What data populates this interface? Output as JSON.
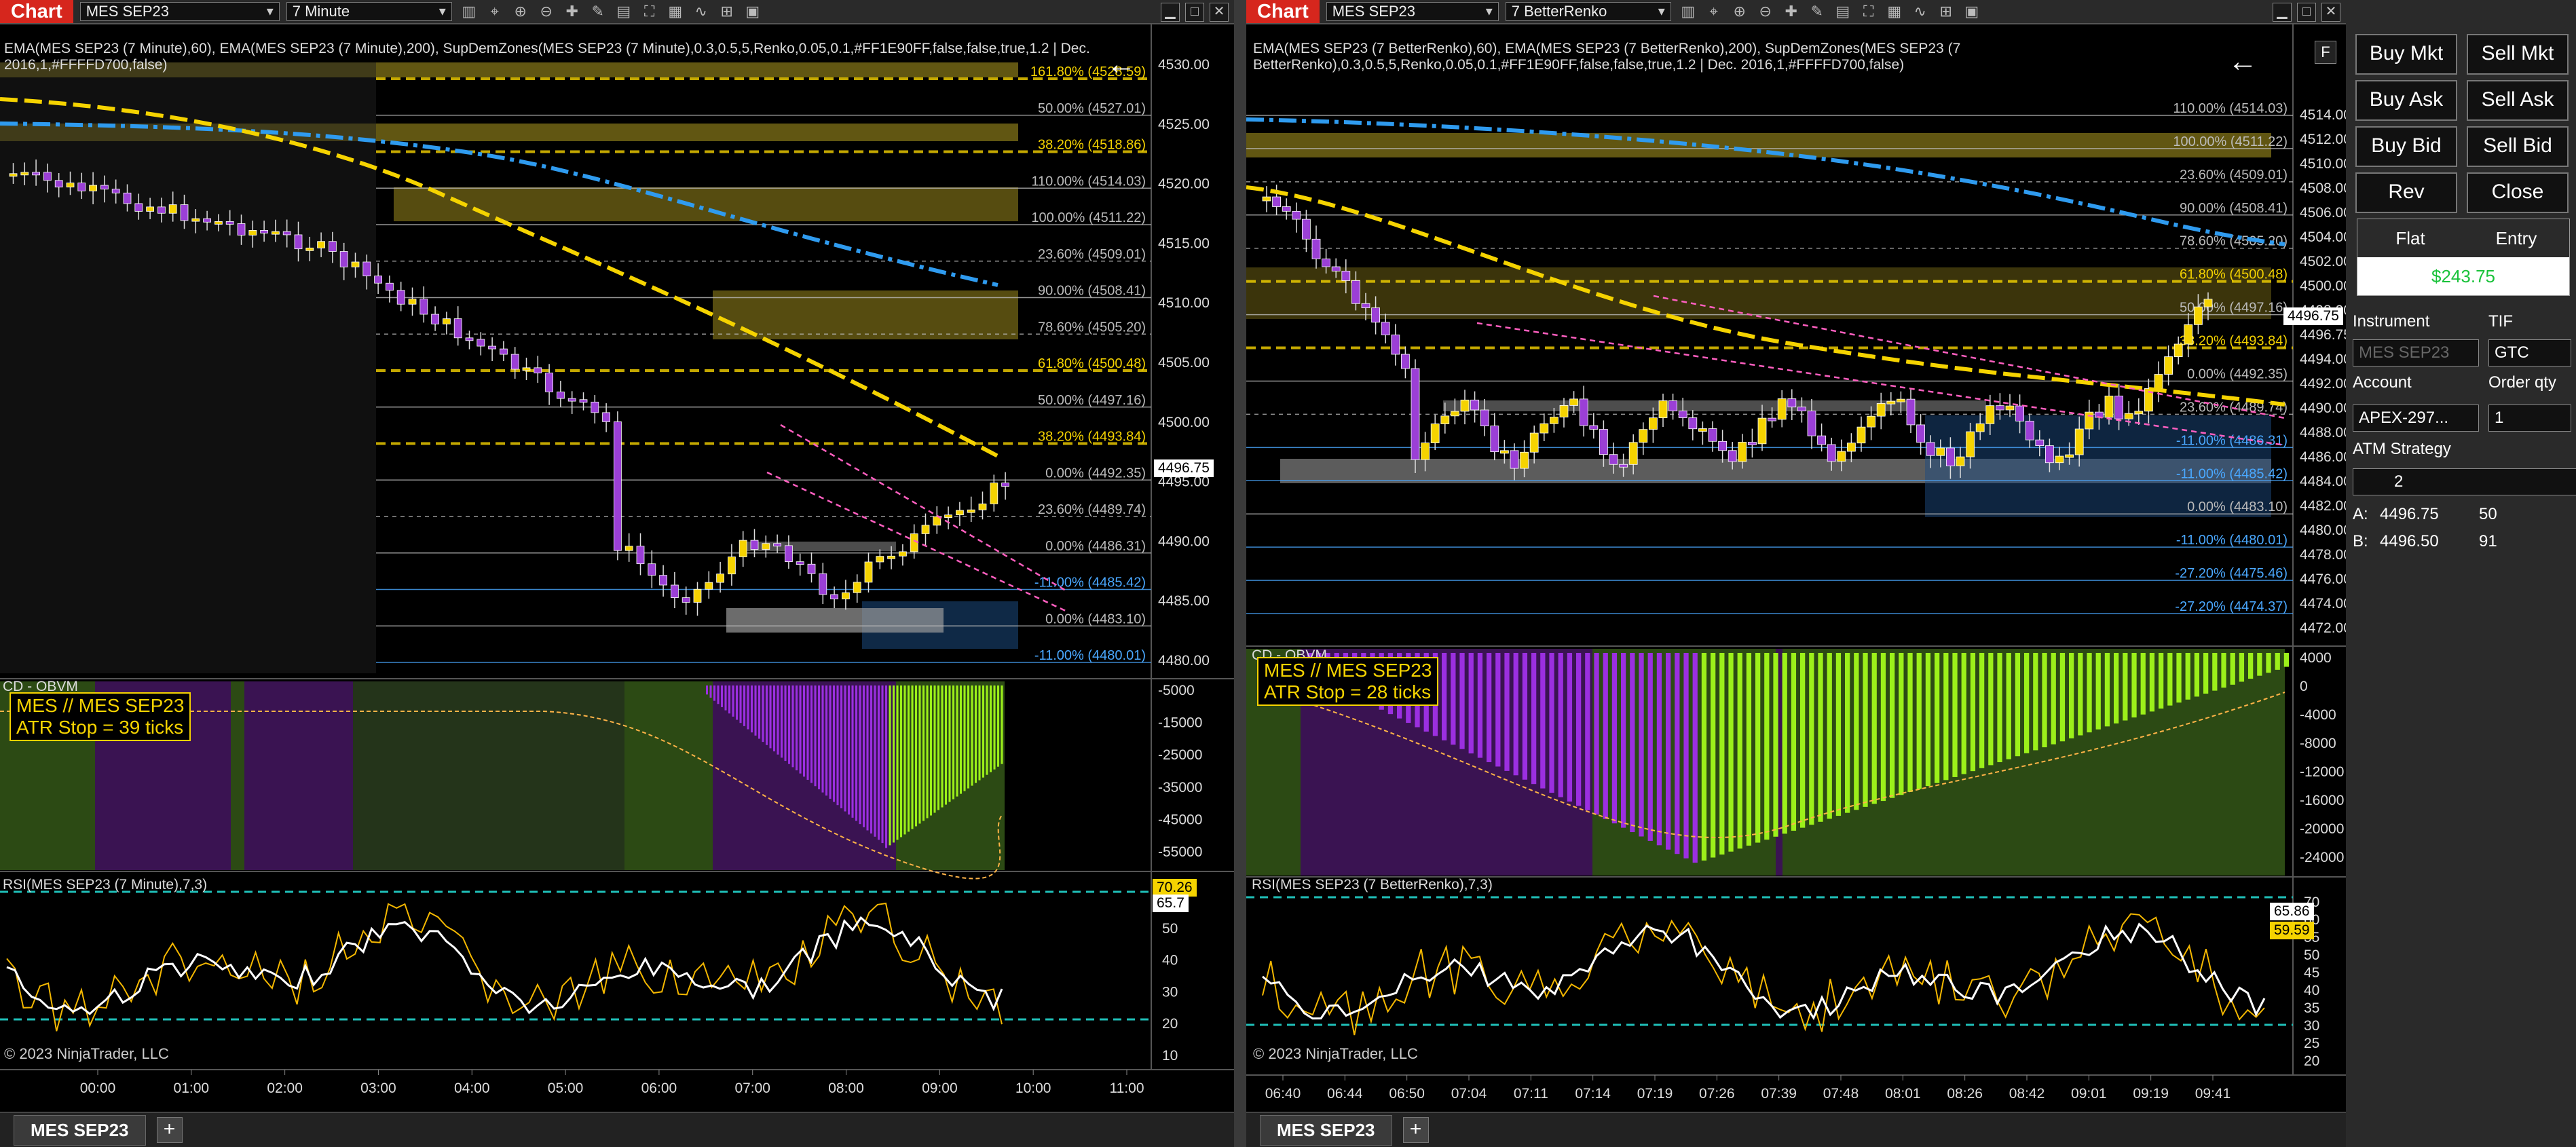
{
  "left_chart": {
    "tab_label": "Chart",
    "instrument": "MES SEP23",
    "interval": "7 Minute",
    "indicator_text_line1": "EMA(MES SEP23 (7 Minute),60), EMA(MES SEP23 (7 Minute),200), SupDemZones(MES SEP23 (7 Minute),0.3,0.5,5,Renko,0.05,0.1,#FF1E90FF,false,false,true,1.2 | Dec.",
    "indicator_text_line2": "2016,1,#FFFFD700,false)",
    "price_axis": [
      "4530.00",
      "4525.00",
      "4520.00",
      "4515.00",
      "4510.00",
      "4505.00",
      "4500.00",
      "4495.00",
      "4490.00",
      "4485.00",
      "4480.00"
    ],
    "last_price": "4496.75",
    "fib_labels": [
      "161.80% (4528.59)",
      "50.00% (4527.01)",
      "38.20% (4518.86)",
      "110.00% (4514.03)",
      "100.00% (4511.22)",
      "23.60% (4509.01)",
      "90.00% (4508.41)",
      "78.60% (4505.20)",
      "61.80% (4500.48)",
      "50.00% (4497.16)",
      "38.20% (4493.84)",
      "0.00% (4492.35)",
      "23.60% (4489.74)",
      "0.00% (4486.31)",
      "-11.00% (4485.42)",
      "0.00% (4483.10)",
      "-11.00% (4480.01)"
    ],
    "obv_title": "CD - OBVM",
    "obv_axis": [
      "-5000",
      "-15000",
      "-25000",
      "-35000",
      "-45000",
      "-55000"
    ],
    "atr_line1": "MES // MES SEP23",
    "atr_line2": "ATR Stop = 39 ticks",
    "rsi_title": "RSI(MES SEP23 (7 Minute),7,3)",
    "rsi_axis": [
      "60",
      "50",
      "40",
      "30",
      "20",
      "10"
    ],
    "rsi_val1": "70.26",
    "rsi_val2": "65.7",
    "copyright": "© 2023 NinjaTrader, LLC",
    "time_axis": [
      "00:00",
      "01:00",
      "02:00",
      "03:00",
      "04:00",
      "05:00",
      "06:00",
      "07:00",
      "08:00",
      "09:00",
      "10:00",
      "11:00"
    ],
    "bottom_tab": "MES SEP23",
    "add_tab": "+"
  },
  "right_chart": {
    "tab_label": "Chart",
    "instrument": "MES SEP23",
    "interval": "7 BetterRenko",
    "indicator_text_line1": "EMA(MES SEP23 (7 BetterRenko),60), EMA(MES SEP23 (7 BetterRenko),200), SupDemZones(MES SEP23 (7",
    "indicator_text_line2": "BetterRenko),0.3,0.5,5,Renko,0.05,0.1,#FF1E90FF,false,false,true,1.2 | Dec. 2016,1,#FFFFD700,false)",
    "price_axis": [
      "4514.00",
      "4512.00",
      "4510.00",
      "4508.00",
      "4506.00",
      "4504.00",
      "4502.00",
      "4500.00",
      "4498.00",
      "4496.75",
      "4494.00",
      "4492.00",
      "4490.00",
      "4488.00",
      "4486.00",
      "4484.00",
      "4482.00",
      "4480.00",
      "4478.00",
      "4476.00",
      "4474.00",
      "4472.00"
    ],
    "last_price": "4496.75",
    "fib_labels": [
      "110.00% (4514.03)",
      "100.00% (4511.22)",
      "23.60% (4509.01)",
      "90.00% (4508.41)",
      "78.60% (4505.20)",
      "61.80% (4500.48)",
      "50.00% (4497.16)",
      "38.20% (4493.84)",
      "0.00% (4492.35)",
      "23.60% (4489.74)",
      "-11.00% (4486.31)",
      "-11.00% (4485.42)",
      "0.00% (4483.10)",
      "-11.00% (4480.01)",
      "-27.20% (4475.46)",
      "-27.20% (4474.37)"
    ],
    "obv_title": "CD - OBVM",
    "obv_axis": [
      "4000",
      "0",
      "-4000",
      "-8000",
      "-12000",
      "-16000",
      "-20000",
      "-24000"
    ],
    "atr_line1": "MES // MES SEP23",
    "atr_line2": "ATR Stop = 28 ticks",
    "rsi_title": "RSI(MES SEP23 (7 BetterRenko),7,3)",
    "rsi_axis": [
      "70",
      "60",
      "55",
      "50",
      "45",
      "40",
      "35",
      "30",
      "25",
      "20"
    ],
    "rsi_val1": "65.86",
    "rsi_val2": "59.59",
    "copyright": "© 2023 NinjaTrader, LLC",
    "time_axis": [
      "06:40",
      "06:44",
      "06:50",
      "07:04",
      "07:11",
      "07:14",
      "07:19",
      "07:26",
      "07:39",
      "07:48",
      "08:01",
      "08:26",
      "08:42",
      "09:01",
      "09:19",
      "09:41"
    ],
    "bottom_tab": "MES SEP23",
    "add_tab": "+"
  },
  "trade_panel": {
    "buy_mkt": "Buy Mkt",
    "sell_mkt": "Sell Mkt",
    "buy_ask": "Buy Ask",
    "sell_ask": "Sell Ask",
    "buy_bid": "Buy Bid",
    "sell_bid": "Sell Bid",
    "rev": "Rev",
    "close": "Close",
    "position": "Flat",
    "entry": "Entry",
    "pnl": "$243.75",
    "instrument_label": "Instrument",
    "instrument_value": "MES SEP23",
    "tif_label": "TIF",
    "tif_value": "GTC",
    "account_label": "Account",
    "account_value": "APEX-297...",
    "qty_label": "Order qty",
    "qty_value": "1",
    "atm_label": "ATM Strategy",
    "atm_value": "2",
    "ask_label": "A:",
    "ask_price": "4496.75",
    "ask_size": "50",
    "bid_label": "B:",
    "bid_price": "4496.50",
    "bid_size": "91",
    "f_label": "F"
  },
  "colors": {
    "bull": "#f5d300",
    "bear": "#9b3fd6",
    "ema60": "#f5d300",
    "ema200": "#2f9bef",
    "obv_up": "#9cf01a",
    "obv_down": "#8e1cc8",
    "zone": "#5b5114",
    "pnl": "#19c23a"
  }
}
